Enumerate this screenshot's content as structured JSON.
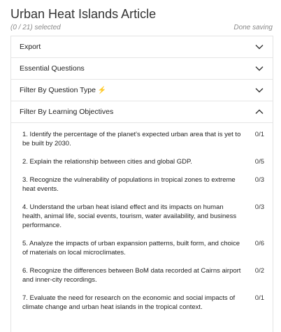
{
  "header": {
    "title": "Urban Heat Islands Article",
    "selection_status": "(0 / 21) selected",
    "save_status": "Done saving"
  },
  "sections": [
    {
      "label": "Export",
      "expanded": false
    },
    {
      "label": "Essential Questions",
      "expanded": false
    },
    {
      "label": "Filter By Question Type",
      "icon": "lightning-bolt-icon",
      "icon_glyph": "⚡",
      "expanded": false
    },
    {
      "label": "Filter By Learning Objectives",
      "expanded": true
    }
  ],
  "objectives": [
    {
      "text": "1. Identify the percentage of the planet's expected urban area that is yet to be built by 2030.",
      "count": "0/1"
    },
    {
      "text": "2. Explain the relationship between cities and global GDP.",
      "count": "0/5"
    },
    {
      "text": "3. Recognize the vulnerability of populations in tropical zones to extreme heat events.",
      "count": "0/3"
    },
    {
      "text": "4. Understand the urban heat island effect and its impacts on human health, animal life, social events, tourism, water availability, and business performance.",
      "count": "0/3"
    },
    {
      "text": "5. Analyze the impacts of urban expansion patterns, built form, and choice of materials on local microclimates.",
      "count": "0/6"
    },
    {
      "text": "6. Recognize the differences between BoM data recorded at Cairns airport and inner-city recordings.",
      "count": "0/2"
    },
    {
      "text": "7. Evaluate the need for research on the economic and social impacts of climate change and urban heat islands in the tropical context.",
      "count": "0/1"
    }
  ]
}
